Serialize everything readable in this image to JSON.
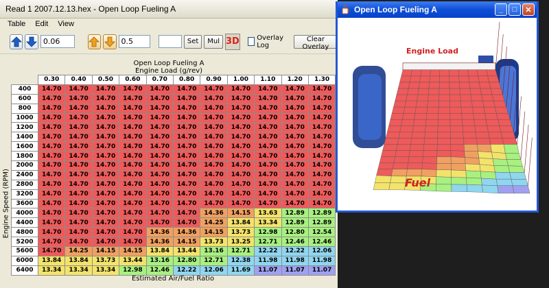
{
  "main_window": {
    "title": "Read 1 2007.12.13.hex - Open Loop Fueling A",
    "menu": [
      "Table",
      "Edit",
      "View"
    ],
    "toolbar": {
      "increment_small": "0.06",
      "increment_large": "0.5",
      "set_value": "",
      "set_label": "Set",
      "mul_label": "Mul",
      "btn_3d_label": "3D",
      "overlay_log_label": "Overlay Log",
      "clear_overlay_label": "Clear Overlay"
    },
    "table_title": "Open Loop Fueling A",
    "x_axis_label": "Engine Load (g/rev)",
    "y_axis_label": "Engine Speed (RPM)",
    "z_axis_label": "Estimated Air/Fuel Ratio",
    "columns": [
      "0.30",
      "0.40",
      "0.50",
      "0.60",
      "0.70",
      "0.80",
      "0.90",
      "1.00",
      "1.10",
      "1.20",
      "1.30"
    ],
    "rows": [
      {
        "rpm": "400",
        "values": [
          "14.70",
          "14.70",
          "14.70",
          "14.70",
          "14.70",
          "14.70",
          "14.70",
          "14.70",
          "14.70",
          "14.70",
          "14.70"
        ]
      },
      {
        "rpm": "600",
        "values": [
          "14.70",
          "14.70",
          "14.70",
          "14.70",
          "14.70",
          "14.70",
          "14.70",
          "14.70",
          "14.70",
          "14.70",
          "14.70"
        ]
      },
      {
        "rpm": "800",
        "values": [
          "14.70",
          "14.70",
          "14.70",
          "14.70",
          "14.70",
          "14.70",
          "14.70",
          "14.70",
          "14.70",
          "14.70",
          "14.70"
        ]
      },
      {
        "rpm": "1000",
        "values": [
          "14.70",
          "14.70",
          "14.70",
          "14.70",
          "14.70",
          "14.70",
          "14.70",
          "14.70",
          "14.70",
          "14.70",
          "14.70"
        ]
      },
      {
        "rpm": "1200",
        "values": [
          "14.70",
          "14.70",
          "14.70",
          "14.70",
          "14.70",
          "14.70",
          "14.70",
          "14.70",
          "14.70",
          "14.70",
          "14.70"
        ]
      },
      {
        "rpm": "1400",
        "values": [
          "14.70",
          "14.70",
          "14.70",
          "14.70",
          "14.70",
          "14.70",
          "14.70",
          "14.70",
          "14.70",
          "14.70",
          "14.70"
        ]
      },
      {
        "rpm": "1600",
        "values": [
          "14.70",
          "14.70",
          "14.70",
          "14.70",
          "14.70",
          "14.70",
          "14.70",
          "14.70",
          "14.70",
          "14.70",
          "14.70"
        ]
      },
      {
        "rpm": "1800",
        "values": [
          "14.70",
          "14.70",
          "14.70",
          "14.70",
          "14.70",
          "14.70",
          "14.70",
          "14.70",
          "14.70",
          "14.70",
          "14.70"
        ]
      },
      {
        "rpm": "2000",
        "values": [
          "14.70",
          "14.70",
          "14.70",
          "14.70",
          "14.70",
          "14.70",
          "14.70",
          "14.70",
          "14.70",
          "14.70",
          "14.70"
        ]
      },
      {
        "rpm": "2400",
        "values": [
          "14.70",
          "14.70",
          "14.70",
          "14.70",
          "14.70",
          "14.70",
          "14.70",
          "14.70",
          "14.70",
          "14.70",
          "14.70"
        ]
      },
      {
        "rpm": "2800",
        "values": [
          "14.70",
          "14.70",
          "14.70",
          "14.70",
          "14.70",
          "14.70",
          "14.70",
          "14.70",
          "14.70",
          "14.70",
          "14.70"
        ]
      },
      {
        "rpm": "3200",
        "values": [
          "14.70",
          "14.70",
          "14.70",
          "14.70",
          "14.70",
          "14.70",
          "14.70",
          "14.70",
          "14.70",
          "14.70",
          "14.70"
        ]
      },
      {
        "rpm": "3600",
        "values": [
          "14.70",
          "14.70",
          "14.70",
          "14.70",
          "14.70",
          "14.70",
          "14.70",
          "14.70",
          "14.70",
          "14.70",
          "14.70"
        ]
      },
      {
        "rpm": "4000",
        "values": [
          "14.70",
          "14.70",
          "14.70",
          "14.70",
          "14.70",
          "14.70",
          "14.36",
          "14.15",
          "13.63",
          "12.89",
          "12.89"
        ]
      },
      {
        "rpm": "4400",
        "values": [
          "14.70",
          "14.70",
          "14.70",
          "14.70",
          "14.70",
          "14.70",
          "14.25",
          "13.84",
          "13.34",
          "12.89",
          "12.89"
        ]
      },
      {
        "rpm": "4800",
        "values": [
          "14.70",
          "14.70",
          "14.70",
          "14.70",
          "14.36",
          "14.36",
          "14.15",
          "13.73",
          "12.98",
          "12.80",
          "12.54"
        ]
      },
      {
        "rpm": "5200",
        "values": [
          "14.70",
          "14.70",
          "14.70",
          "14.70",
          "14.36",
          "14.15",
          "13.73",
          "13.25",
          "12.71",
          "12.46",
          "12.46"
        ]
      },
      {
        "rpm": "5600",
        "values": [
          "14.70",
          "14.25",
          "14.15",
          "14.15",
          "13.84",
          "13.44",
          "13.16",
          "12.71",
          "12.22",
          "12.22",
          "12.06"
        ]
      },
      {
        "rpm": "6000",
        "values": [
          "13.84",
          "13.84",
          "13.73",
          "13.44",
          "13.16",
          "12.80",
          "12.71",
          "12.38",
          "11.98",
          "11.98",
          "11.98"
        ]
      },
      {
        "rpm": "6400",
        "values": [
          "13.34",
          "13.34",
          "13.34",
          "12.98",
          "12.46",
          "12.22",
          "12.06",
          "11.69",
          "11.07",
          "11.07",
          "11.07"
        ]
      }
    ]
  },
  "view3d_window": {
    "title": "Open Loop Fueling A",
    "axis_label_load": "Engine Load",
    "axis_label_fuel": "Fuel"
  },
  "colors": {
    "high": "#ef5a5a",
    "mid_high": "#f0a060",
    "mid": "#f3e36a",
    "mid_low": "#a8f080",
    "low": "#8fd6f0",
    "lowest": "#a0a0f0"
  }
}
